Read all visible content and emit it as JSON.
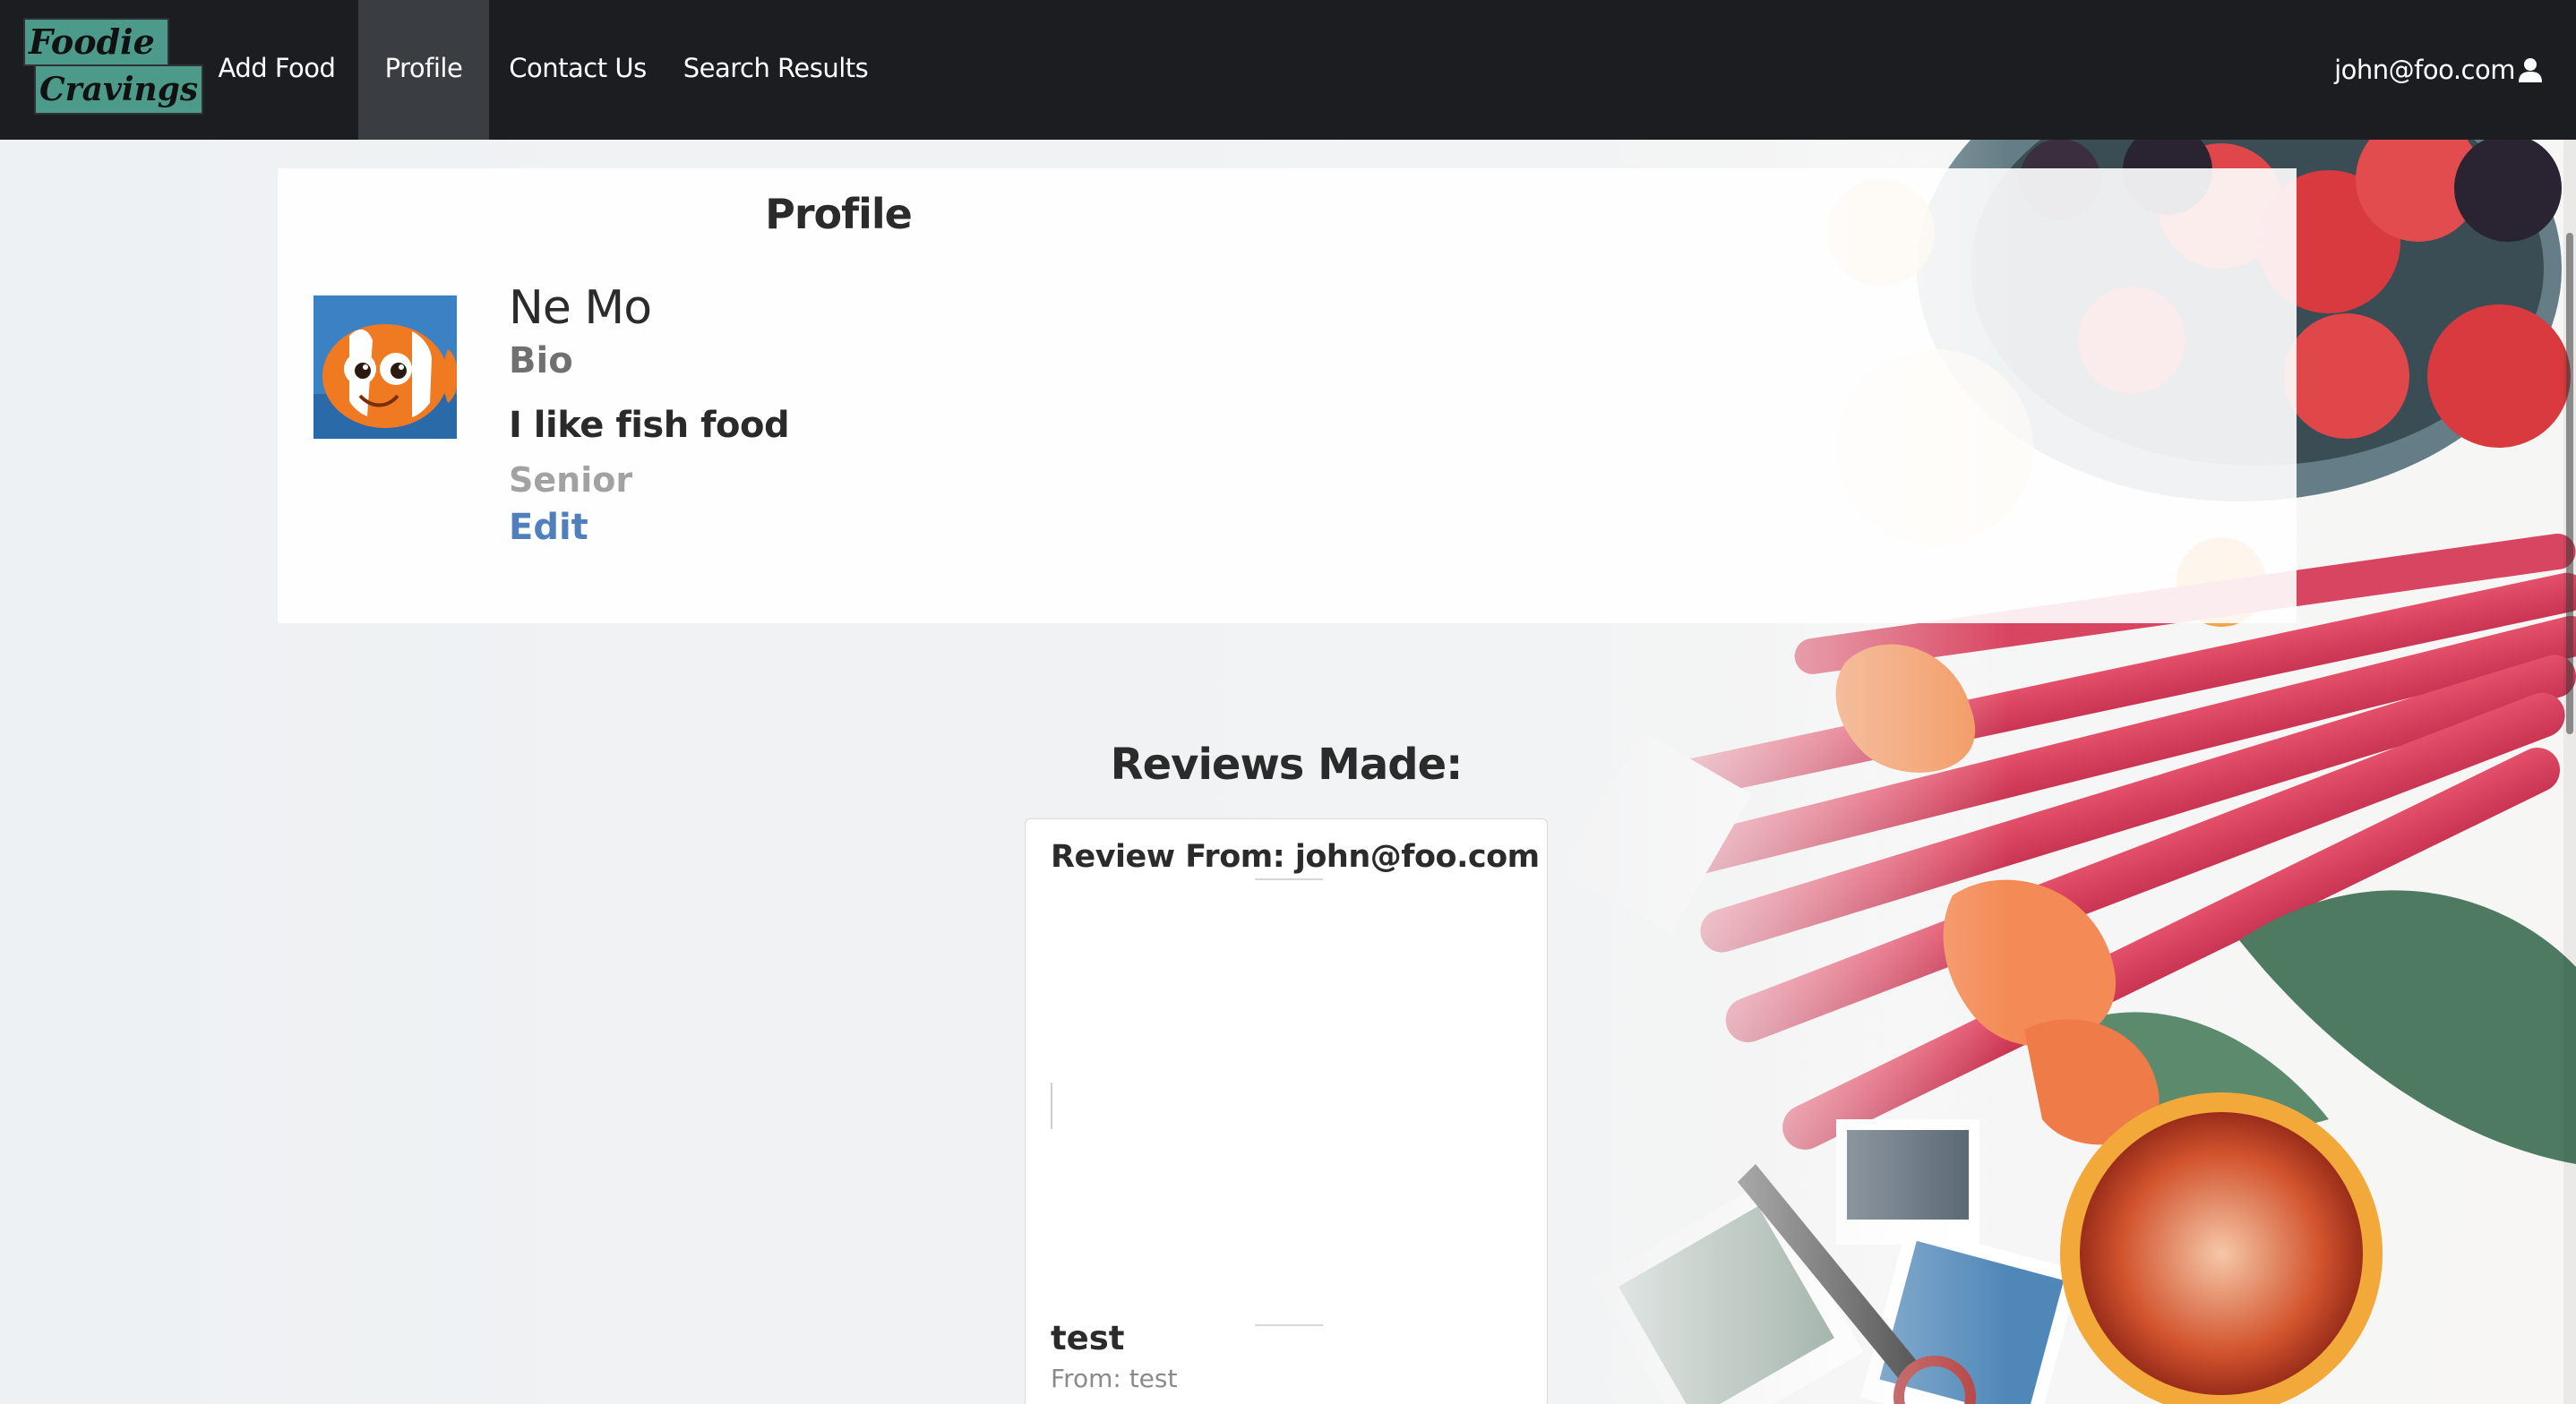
{
  "nav": {
    "brand_line1": "Foodie",
    "brand_line2": "Cravings",
    "items": [
      {
        "label": "Add Food"
      },
      {
        "label": "Profile",
        "active": true
      },
      {
        "label": "Contact Us"
      },
      {
        "label": "Search Results"
      }
    ],
    "user_email": "john@foo.com",
    "user_icon": "user-icon"
  },
  "profile": {
    "title": "Profile",
    "name": "Ne Mo",
    "bio_label": "Bio",
    "bio": "I like fish food",
    "level": "Senior",
    "edit_label": "Edit",
    "avatar_icon": "clownfish-avatar"
  },
  "reviews": {
    "heading": "Reviews Made:",
    "items": [
      {
        "from_label": "Review From: john@foo.com",
        "title": "test",
        "author_label": "From: test"
      }
    ]
  },
  "colors": {
    "navbar": "#1b1d20",
    "active_tab": "#3a3d42",
    "brand_green": "#4c9a8a",
    "edit_link": "#4f80bd"
  }
}
